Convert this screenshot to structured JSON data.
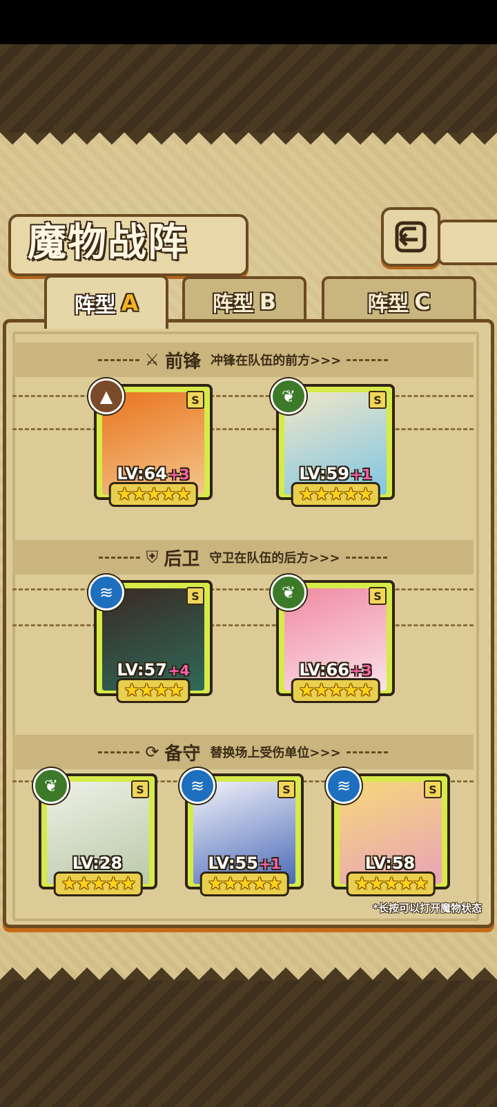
{
  "header": {
    "title": "魔物战阵"
  },
  "tabs": [
    {
      "label": "阵型",
      "letter": "A",
      "active": true
    },
    {
      "label": "阵型",
      "letter": "B",
      "active": false
    },
    {
      "label": "阵型",
      "letter": "C",
      "active": false
    }
  ],
  "sections": {
    "front": {
      "icon": "sword-icon",
      "title": "前锋",
      "subtitle": "冲锋在队伍的前方>>>"
    },
    "rear": {
      "icon": "shield-icon",
      "title": "后卫",
      "subtitle": "守卫在队伍的后方>>>"
    },
    "reserve": {
      "icon": "swap-icon",
      "title": "备守",
      "subtitle": "替换场上受伤单位>>>"
    }
  },
  "monsters": [
    {
      "element": "earth",
      "element_color": "#7a4a2a",
      "rank": "S",
      "level": "LV:64",
      "plus": "+3",
      "stars": "★★★★★",
      "art": [
        "#e8741e",
        "#f4c68a"
      ]
    },
    {
      "element": "nature",
      "element_color": "#3c7a2a",
      "rank": "S",
      "level": "LV:59",
      "plus": "+1",
      "stars": "★★★★★",
      "art": [
        "#f0e6c6",
        "#7fc6e4"
      ]
    },
    {
      "element": "water",
      "element_color": "#1f6fbf",
      "rank": "S",
      "level": "LV:57",
      "plus": "+4",
      "stars": "★★★★",
      "art": [
        "#3a2a22",
        "#2f6a5a"
      ]
    },
    {
      "element": "nature",
      "element_color": "#3c7a2a",
      "rank": "S",
      "level": "LV:66",
      "plus": "+3",
      "stars": "★★★★★",
      "art": [
        "#f08aa2",
        "#fbe2ea"
      ]
    },
    {
      "element": "nature",
      "element_color": "#3c7a2a",
      "rank": "S",
      "level": "LV:28",
      "plus": "",
      "stars": "★★★★★",
      "art": [
        "#eef0e6",
        "#b9c9a8"
      ]
    },
    {
      "element": "water",
      "element_color": "#1f6fbf",
      "rank": "S",
      "level": "LV:55",
      "plus": "+1",
      "stars": "★★★★★",
      "art": [
        "#f2f2f8",
        "#4a6ab8"
      ]
    },
    {
      "element": "water",
      "element_color": "#1f6fbf",
      "rank": "S",
      "level": "LV:58",
      "plus": "",
      "stars": "★★★★★",
      "art": [
        "#f6d77a",
        "#e9a3b8"
      ]
    }
  ],
  "footnote": "*长按可以打开魔物状态"
}
